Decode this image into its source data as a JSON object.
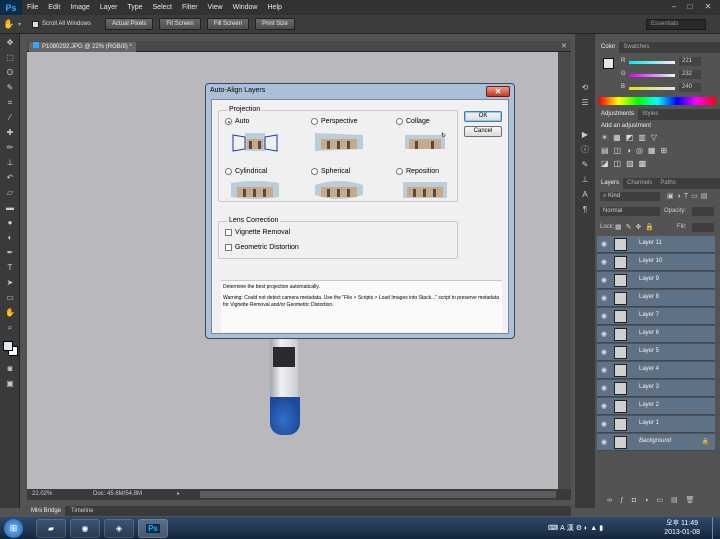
{
  "menubar": {
    "logo": "Ps",
    "items": [
      "File",
      "Edit",
      "Image",
      "Layer",
      "Type",
      "Select",
      "Filter",
      "View",
      "Window",
      "Help"
    ]
  },
  "options": {
    "scroll_all_windows": "Scroll All Windows",
    "actual_pixels": "Actual Pixels",
    "fit_screen": "Fit Screen",
    "fill_screen": "Fill Screen",
    "print_size": "Print Size",
    "workspace": "Essentials"
  },
  "document": {
    "tab_title": "P1080292.JPG @ 22% (RGB/8) *",
    "zoom": "22.02%",
    "doc_size": "Doc: 45.6M/54.8M"
  },
  "bottom_tabs": [
    "Mini Bridge",
    "Timeline"
  ],
  "panels": {
    "color_tabs": [
      "Color",
      "Swatches"
    ],
    "color_channels": [
      {
        "label": "R",
        "value": "221"
      },
      {
        "label": "G",
        "value": "232"
      },
      {
        "label": "B",
        "value": "240"
      }
    ],
    "adjust_tabs": [
      "Adjustments",
      "Styles"
    ],
    "adjust_title": "Add an adjustment",
    "layers_tabs": [
      "Layers",
      "Channels",
      "Paths"
    ],
    "kind_label": "Kind",
    "blend_mode": "Normal",
    "opacity_label": "Opacity:",
    "lock_label": "Lock:",
    "fill_label": "Fill:",
    "layers": [
      "Layer 11",
      "Layer 10",
      "Layer 9",
      "Layer 8",
      "Layer 7",
      "Layer 6",
      "Layer 5",
      "Layer 4",
      "Layer 3",
      "Layer 2",
      "Layer 1",
      "Background"
    ]
  },
  "dialog": {
    "title": "Auto-Align Layers",
    "projection_label": "Projection",
    "options": [
      "Auto",
      "Perspective",
      "Collage",
      "Cylindrical",
      "Spherical",
      "Reposition"
    ],
    "selected": "Auto",
    "lens_label": "Lens Correction",
    "vignette": "Vignette Removal",
    "geometric": "Geometric Distortion",
    "ok": "OK",
    "cancel": "Cancel",
    "description": "Determine the best projection automatically.",
    "warning": "Warning: Could not detect camera metadata. Use the \"File > Scripts > Load Images into Stack...\" script to preserve metadata for Vignette Removal and/or Geometric Distortion."
  },
  "taskbar": {
    "time": "오후 11:49",
    "date": "2013-01-08"
  }
}
